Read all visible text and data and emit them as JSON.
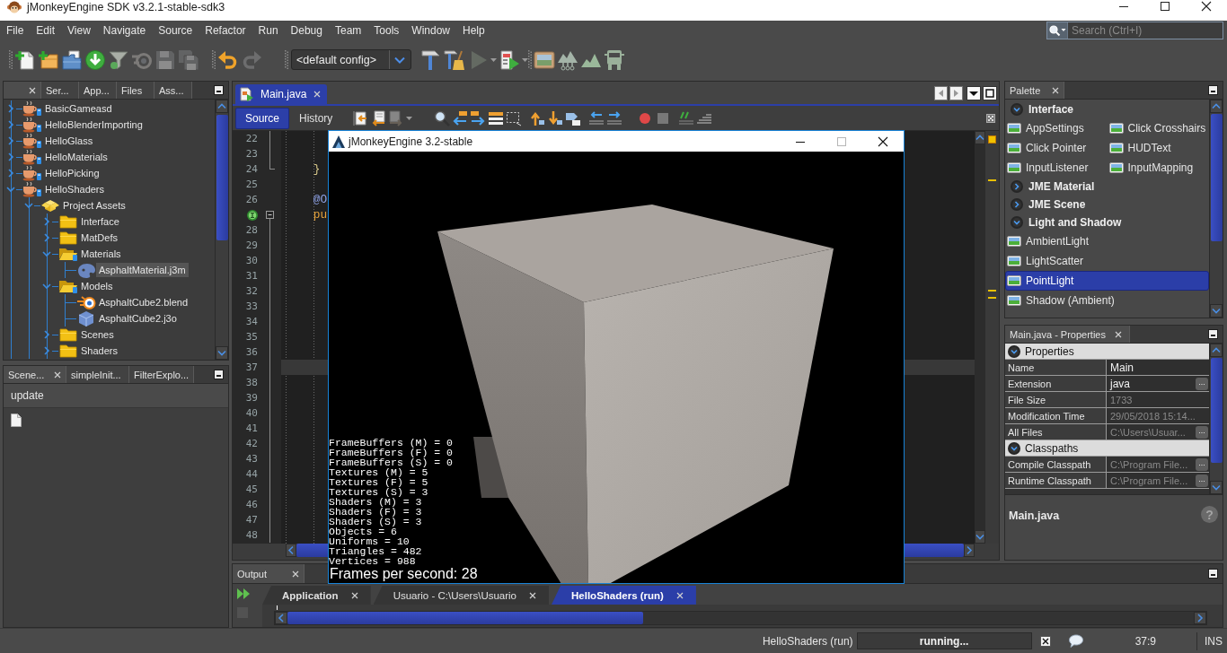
{
  "window": {
    "title": "jMonkeyEngine SDK v3.2.1-stable-sdk3"
  },
  "menu": [
    "File",
    "Edit",
    "View",
    "Navigate",
    "Source",
    "Refactor",
    "Run",
    "Debug",
    "Team",
    "Tools",
    "Window",
    "Help"
  ],
  "search": {
    "placeholder": "Search (Ctrl+I)"
  },
  "toolbar": {
    "groups": [
      [
        {
          "kind": "newfile",
          "disabled": false
        },
        {
          "kind": "newproject",
          "disabled": false
        },
        {
          "kind": "open",
          "disabled": false
        },
        {
          "kind": "download",
          "disabled": false
        },
        {
          "kind": "filter",
          "disabled": false
        },
        {
          "kind": "blender",
          "disabled": true
        },
        {
          "kind": "save",
          "disabled": true
        },
        {
          "kind": "saveall",
          "disabled": true
        }
      ],
      [
        {
          "kind": "undo",
          "disabled": false
        },
        {
          "kind": "redo",
          "disabled": true
        }
      ],
      [
        {
          "kind": "config",
          "value": "<default config>"
        },
        {
          "kind": "build",
          "disabled": false
        },
        {
          "kind": "clean",
          "disabled": false
        },
        {
          "kind": "run",
          "disabled": true
        },
        {
          "kind": "profile",
          "disabled": false
        }
      ],
      [
        {
          "kind": "picture",
          "disabled": false
        },
        {
          "kind": "nodes",
          "disabled": false
        },
        {
          "kind": "terrain",
          "disabled": false
        },
        {
          "kind": "truck",
          "disabled": false
        }
      ]
    ]
  },
  "projects": {
    "tabs": [
      {
        "selected": true
      },
      {
        "label": "Ser...",
        "selected": false
      },
      {
        "label": "App...",
        "selected": false
      },
      {
        "label": "Files",
        "selected": false
      },
      {
        "label": "Ass...",
        "selected": false
      }
    ],
    "tree": [
      {
        "label": "BasicGameasd",
        "kind": "project",
        "expanded": false,
        "selected": false
      },
      {
        "label": "HelloBlenderImporting",
        "kind": "project",
        "expanded": false,
        "selected": false
      },
      {
        "label": "HelloGlass",
        "kind": "project",
        "expanded": false,
        "selected": false
      },
      {
        "label": "HelloMaterials",
        "kind": "project",
        "expanded": false,
        "selected": false
      },
      {
        "label": "HelloPicking",
        "kind": "project",
        "expanded": false,
        "selected": false
      },
      {
        "label": "HelloShaders",
        "kind": "project",
        "expanded": true,
        "selected": false,
        "children": [
          {
            "label": "Project Assets",
            "kind": "assets",
            "expanded": true,
            "selected": false,
            "children": [
              {
                "label": "Interface",
                "kind": "folder",
                "expanded": false,
                "selected": false
              },
              {
                "label": "MatDefs",
                "kind": "folder",
                "expanded": false,
                "selected": false
              },
              {
                "label": "Materials",
                "kind": "folder",
                "expanded": true,
                "selected": false,
                "children": [
                  {
                    "label": "AsphaltMaterial.j3m",
                    "kind": "material",
                    "selected": true
                  }
                ]
              },
              {
                "label": "Models",
                "kind": "folder",
                "expanded": true,
                "selected": false,
                "children": [
                  {
                    "label": "AsphaltCube2.blend",
                    "kind": "blend",
                    "selected": false
                  },
                  {
                    "label": "AsphaltCube2.j3o",
                    "kind": "model",
                    "selected": false
                  }
                ]
              },
              {
                "label": "Scenes",
                "kind": "folder",
                "expanded": false,
                "selected": false
              },
              {
                "label": "Shaders",
                "kind": "folder",
                "expanded": false,
                "selected": false
              }
            ]
          }
        ]
      }
    ]
  },
  "navigator": {
    "tabs": [
      {
        "label": "Scene...",
        "selected": true
      },
      {
        "label": "simpleInit...",
        "selected": false
      },
      {
        "label": "FilterExplo...",
        "selected": false
      }
    ],
    "items": [
      {
        "kind": "method",
        "label": "update"
      },
      {
        "kind": "file"
      }
    ]
  },
  "editor": {
    "tabs": [
      {
        "label": "Main.java",
        "selected": true
      }
    ],
    "views": [
      {
        "label": "Source",
        "selected": true
      },
      {
        "label": "History",
        "selected": false
      }
    ],
    "toolbar": {
      "groups": [
        [
          {
            "kind": "lastedit",
            "disabled": false
          },
          {
            "kind": "back",
            "disabled": false
          },
          {
            "kind": "forward",
            "disabled": true
          }
        ],
        [
          {
            "kind": "find",
            "disabled": false
          },
          {
            "kind": "findprev",
            "disabled": false
          },
          {
            "kind": "findnext",
            "disabled": false
          },
          {
            "kind": "highlight",
            "disabled": false
          },
          {
            "kind": "rectselect",
            "disabled": false
          }
        ],
        [
          {
            "kind": "bookmarkprev",
            "disabled": false
          },
          {
            "kind": "bookmarknext",
            "disabled": false
          },
          {
            "kind": "bookmark",
            "disabled": false
          }
        ],
        [
          {
            "kind": "shiftleft",
            "disabled": false
          },
          {
            "kind": "shiftright",
            "disabled": false
          }
        ],
        [
          {
            "kind": "record",
            "disabled": false
          },
          {
            "kind": "stop",
            "disabled": true
          }
        ],
        [
          {
            "kind": "comment",
            "disabled": false
          },
          {
            "kind": "uncomment",
            "disabled": false
          }
        ]
      ]
    },
    "lines": [
      {
        "number": "22",
        "kind": "fold",
        "current": false,
        "implements_mark": false
      },
      {
        "number": "23",
        "kind": "fold",
        "current": false,
        "implements_mark": false
      },
      {
        "number": "24",
        "kind": "foldend",
        "code": {
          "text": "    }",
          "kind": "brace"
        },
        "current": false,
        "implements_mark": false
      },
      {
        "number": "25",
        "kind": "plain",
        "current": false,
        "implements_mark": false
      },
      {
        "number": "26",
        "kind": "plain",
        "code": {
          "text": "    @O",
          "kind": "annotation"
        },
        "current": false,
        "implements_mark": false
      },
      {
        "kind": "foldstart",
        "code": {
          "text": "    pu",
          "kind": "keyword"
        },
        "current": false,
        "implements_mark": true
      },
      {
        "number": "28",
        "kind": "fold",
        "current": false,
        "implements_mark": false
      },
      {
        "number": "29",
        "kind": "fold",
        "current": false,
        "implements_mark": false
      },
      {
        "number": "30",
        "kind": "fold",
        "current": false,
        "implements_mark": false
      },
      {
        "number": "31",
        "kind": "fold",
        "current": false,
        "implements_mark": false
      },
      {
        "number": "32",
        "kind": "fold",
        "current": false,
        "implements_mark": false
      },
      {
        "number": "33",
        "kind": "fold",
        "current": false,
        "implements_mark": false
      },
      {
        "number": "34",
        "kind": "fold",
        "current": false,
        "implements_mark": false
      },
      {
        "number": "35",
        "kind": "fold",
        "current": false,
        "implements_mark": false
      },
      {
        "number": "36",
        "kind": "fold",
        "current": false,
        "implements_mark": false
      },
      {
        "number": "37",
        "kind": "fold",
        "current": true,
        "implements_mark": false
      },
      {
        "number": "38",
        "kind": "fold",
        "current": false,
        "implements_mark": false
      },
      {
        "number": "39",
        "kind": "fold",
        "current": false,
        "implements_mark": false
      },
      {
        "number": "40",
        "kind": "fold",
        "current": false,
        "implements_mark": false
      },
      {
        "number": "41",
        "kind": "fold",
        "current": false,
        "implements_mark": false
      },
      {
        "number": "42",
        "kind": "fold",
        "current": false,
        "implements_mark": false
      },
      {
        "number": "43",
        "kind": "fold",
        "current": false,
        "implements_mark": false
      },
      {
        "number": "44",
        "kind": "fold",
        "current": false,
        "implements_mark": false
      },
      {
        "number": "45",
        "kind": "fold",
        "current": false,
        "implements_mark": false
      },
      {
        "number": "46",
        "kind": "fold",
        "current": false,
        "implements_mark": false
      },
      {
        "number": "47",
        "kind": "fold",
        "current": false,
        "implements_mark": false
      },
      {
        "number": "48",
        "kind": "fold",
        "current": false,
        "implements_mark": false
      }
    ]
  },
  "game_window": {
    "title": "jMonkeyEngine 3.2-stable",
    "controls": [
      {
        "kind": "minimize",
        "disabled": false
      },
      {
        "kind": "maximize",
        "disabled": true
      },
      {
        "kind": "close",
        "disabled": false
      }
    ],
    "stats": [
      "FrameBuffers (M) = 0",
      "FrameBuffers (F) = 0",
      "FrameBuffers (S) = 0",
      "Textures (M) = 5",
      "Textures (F) = 5",
      "Textures (S) = 3",
      "Shaders (M) = 3",
      "Shaders (F) = 3",
      "Shaders (S) = 3",
      "Objects = 6",
      "Uniforms = 10",
      "Triangles = 482",
      "Vertices = 988"
    ],
    "fps": "Frames per second: 28"
  },
  "palette": {
    "title": "Palette",
    "categories": [
      {
        "label": "Interface",
        "expanded": true,
        "items": [
          {
            "label": "AppSettings",
            "selected": false
          },
          {
            "label": "Click Crosshairs",
            "selected": false
          },
          {
            "label": "Click Pointer",
            "selected": false
          },
          {
            "label": "HUDText",
            "selected": false
          },
          {
            "label": "InputListener",
            "selected": false
          },
          {
            "label": "InputMapping",
            "selected": false
          }
        ]
      },
      {
        "label": "JME Material",
        "expanded": false
      },
      {
        "label": "JME Scene",
        "expanded": false
      },
      {
        "label": "Light and Shadow",
        "expanded": true,
        "items": [
          {
            "label": "AmbientLight",
            "selected": false
          },
          {
            "label": "LightScatter",
            "selected": false
          },
          {
            "label": "PointLight",
            "selected": true
          },
          {
            "label": "Shadow (Ambient)",
            "selected": false
          }
        ]
      }
    ]
  },
  "properties": {
    "title": "Main.java - Properties",
    "sections": [
      {
        "label": "Properties",
        "expanded": true,
        "rows": [
          {
            "name": "Name",
            "value": "Main",
            "read_only": false
          },
          {
            "name": "Extension",
            "value": "java",
            "read_only": false,
            "button": "..."
          },
          {
            "name": "File Size",
            "value": "1733",
            "read_only": true
          },
          {
            "name": "Modification Time",
            "value": "29/05/2018 15:14...",
            "read_only": true
          },
          {
            "name": "All Files",
            "value": "C:\\Users\\Usuar...",
            "read_only": true,
            "button": "..."
          }
        ]
      },
      {
        "label": "Classpaths",
        "expanded": true,
        "rows": [
          {
            "name": "Compile Classpath",
            "value": "C:\\Program File...",
            "read_only": true,
            "button": "..."
          },
          {
            "name": "Runtime Classpath",
            "value": "C:\\Program File...",
            "read_only": true,
            "button": "..."
          }
        ]
      }
    ],
    "description": {
      "title": "Main.java",
      "help": "?"
    }
  },
  "output": {
    "title": "Output",
    "actions": [
      {
        "kind": "rerun",
        "disabled": false
      },
      {
        "kind": "stop",
        "disabled": true
      }
    ],
    "tabs": [
      {
        "label": "Application",
        "selected": false,
        "unread": true
      },
      {
        "label": "Usuario - C:\\Users\\Usuario",
        "selected": false,
        "unread": false
      },
      {
        "label": "HelloShaders (run)",
        "selected": true,
        "unread": true
      }
    ]
  },
  "status_bar": {
    "task": "HelloShaders (run)",
    "progress": "running...",
    "position": "37:9",
    "mode": "INS"
  }
}
